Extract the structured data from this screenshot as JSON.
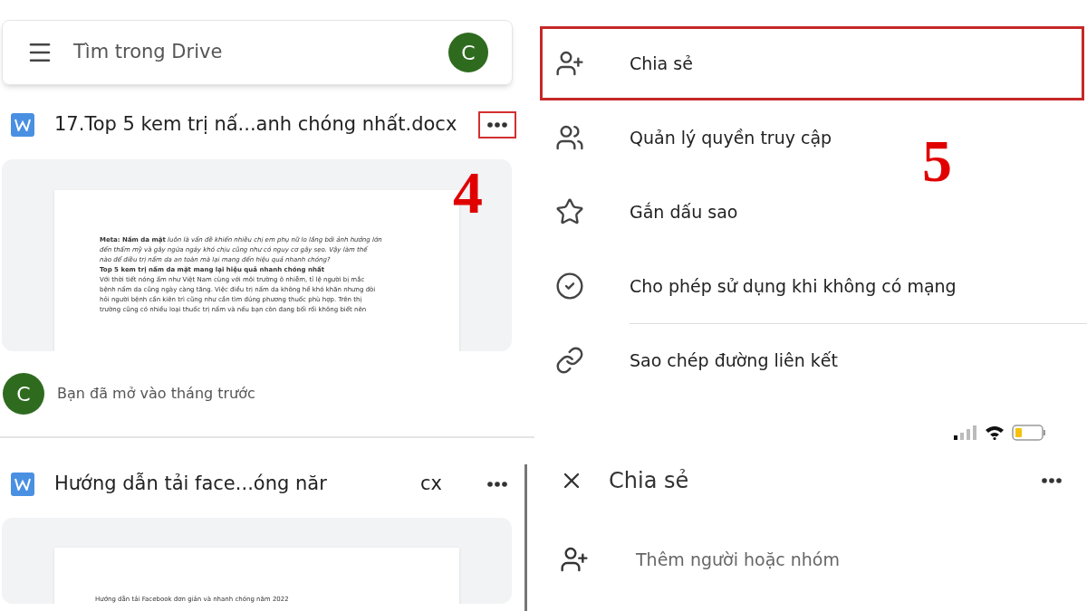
{
  "drive": {
    "search": {
      "placeholder": "Tìm trong Drive"
    },
    "account_initial": "C",
    "files": [
      {
        "name": "17.Top 5 kem trị nấ...anh chóng nhất.docx",
        "highlighted": true,
        "step": "4",
        "preview_lines": [
          "**Meta: Nấm da mặt** *luôn là vấn đề khiến nhiều chị em phụ nữ lo lắng bởi ảnh hưởng lớn*",
          "*đến thẩm mỹ và gây ngứa ngáy khó chịu cũng như có nguy cơ gây sẹo. Vậy làm thế*",
          "*nào để điều trị nấm da an toàn mà lại mang đến hiệu quả nhanh chóng?*",
          "**Top 5 kem trị nấm da mặt mang lại hiệu quả nhanh chóng nhất**",
          "Với thời tiết nóng ẩm như Việt Nam cùng với môi trường ô nhiễm, tỉ lệ người bị mắc",
          "bệnh nấm da cũng ngày càng tăng. Việc điều trị nấm da không hề khó khăn nhưng đòi",
          "hỏi người bệnh cần kiên trì cũng như cần tìm đúng phương thuốc phù hợp. Trên thị",
          "trường cũng có nhiều loại thuốc trị nấm và nếu bạn còn đang bối rối không biết nên"
        ],
        "activity": "Bạn đã mở vào tháng trước",
        "activity_initial": "C"
      },
      {
        "name": "Hướng dẫn tải face...óng năr",
        "name_tail": "cx",
        "highlighted": false,
        "preview_lines": [
          "Hướng dẫn tải Facebook đơn giản và nhanh chóng năm 2022"
        ]
      }
    ]
  },
  "menu": {
    "step": "5",
    "items": [
      {
        "label": "Chia sẻ",
        "kind": "share",
        "selected": true
      },
      {
        "label": "Quản lý quyền truy cập",
        "kind": "access",
        "selected": false
      },
      {
        "label": "Gắn dấu sao",
        "kind": "star",
        "selected": false
      },
      {
        "label": "Cho phép sử dụng khi không có mạng",
        "kind": "offline",
        "selected": false
      },
      {
        "label": "Sao chép đường liên kết",
        "kind": "link",
        "selected": false
      }
    ]
  },
  "share": {
    "title": "Chia sẻ",
    "add": {
      "placeholder": "Thêm người hoặc nhóm"
    }
  }
}
